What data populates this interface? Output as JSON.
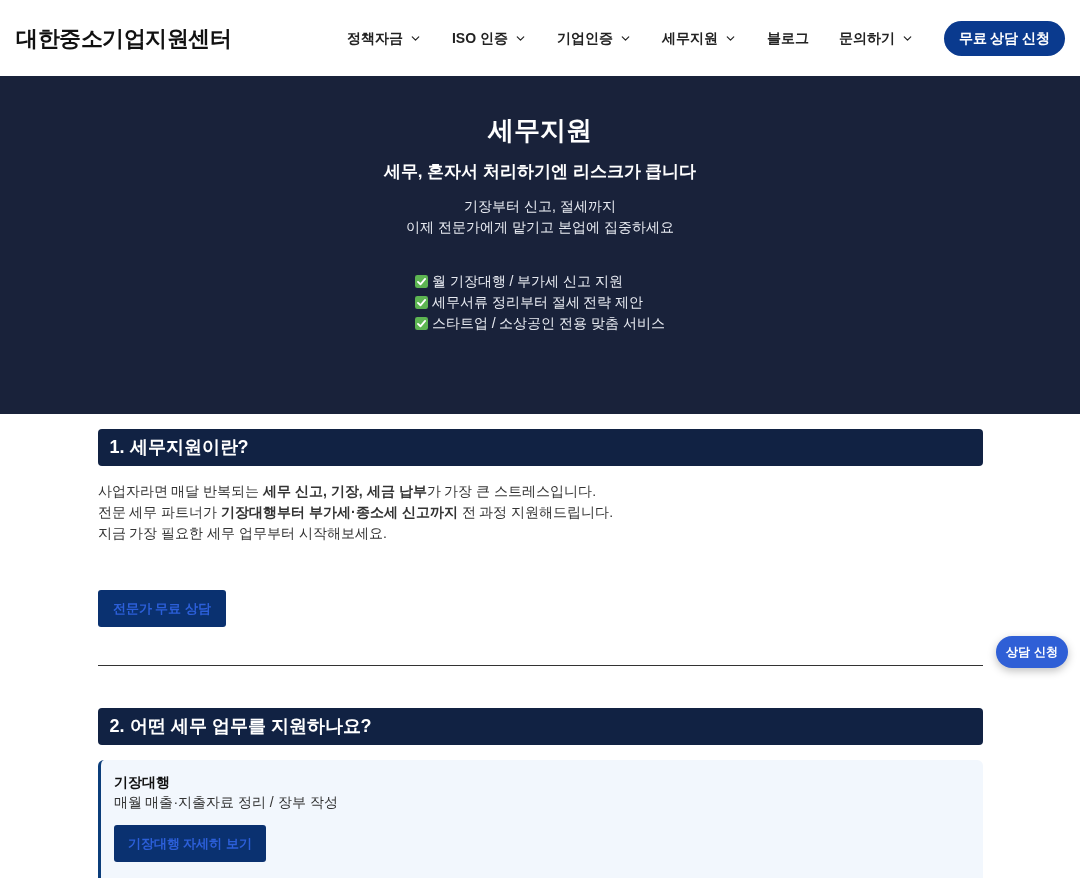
{
  "header": {
    "logo": "대한중소기업지원센터",
    "nav": [
      {
        "label": "정책자금",
        "dropdown": true
      },
      {
        "label": "ISO 인증",
        "dropdown": true
      },
      {
        "label": "기업인증",
        "dropdown": true
      },
      {
        "label": "세무지원",
        "dropdown": true
      },
      {
        "label": "블로그",
        "dropdown": false
      },
      {
        "label": "문의하기",
        "dropdown": true
      }
    ],
    "cta": "무료 상담 신청"
  },
  "hero": {
    "title": "세무지원",
    "subtitle": "세무, 혼자서 처리하기엔 리스크가 큽니다",
    "lines": [
      "기장부터 신고, 절세까지",
      "이제 전문가에게 맡기고 본업에 집중하세요"
    ],
    "checklist": [
      "월 기장대행 / 부가세 신고 지원",
      "세무서류 정리부터 절세 전략 제안",
      "스타트업 / 소상공인 전용 맞춤 서비스"
    ]
  },
  "sections": [
    {
      "heading": "1. 세무지원이란?",
      "paragraph": [
        "사업자라면 매달 반복되는 **세무 신고, 기장, 세금 납부**가 가장 큰 스트레스입니다.",
        "전문 세무 파트너가 **기장대행부터 부가세·종소세 신고까지** 전 과정 지원해드립니다.",
        "지금 가장 필요한 세무 업무부터 시작해보세요."
      ],
      "button": "전문가 무료 상담"
    },
    {
      "heading": "2. 어떤 세무 업무를 지원하나요?",
      "cards": [
        {
          "title": "기장대행",
          "description": "매월 매출·지출자료 정리 / 장부 작성",
          "button": "기장대행 자세히 보기"
        }
      ]
    }
  ],
  "floating_button": "상담 신청"
}
